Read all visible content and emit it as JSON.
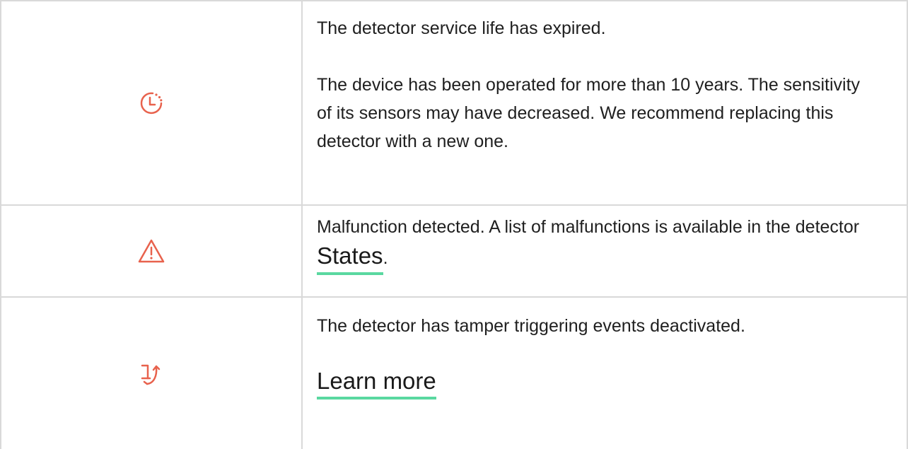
{
  "colors": {
    "icon": "#e8624d",
    "link_underline": "#5ad8a0",
    "border": "#d9d9d9",
    "text": "#1f1f1f"
  },
  "rows": [
    {
      "icon": "clock-service-life-icon",
      "title": "The detector service life has expired.",
      "description": "The device has been operated for more than 10 years. The sensitivity of its sensors may have decreased. We recommend replacing this detector with a new one."
    },
    {
      "icon": "warning-triangle-icon",
      "text_before_link": "Malfunction detected. A list of malfunctions is available in the detector ",
      "link_label": "States",
      "text_after_link": "."
    },
    {
      "icon": "tamper-deactivated-icon",
      "title": "The detector has tamper triggering events deactivated.",
      "link_label": "Learn more"
    }
  ]
}
